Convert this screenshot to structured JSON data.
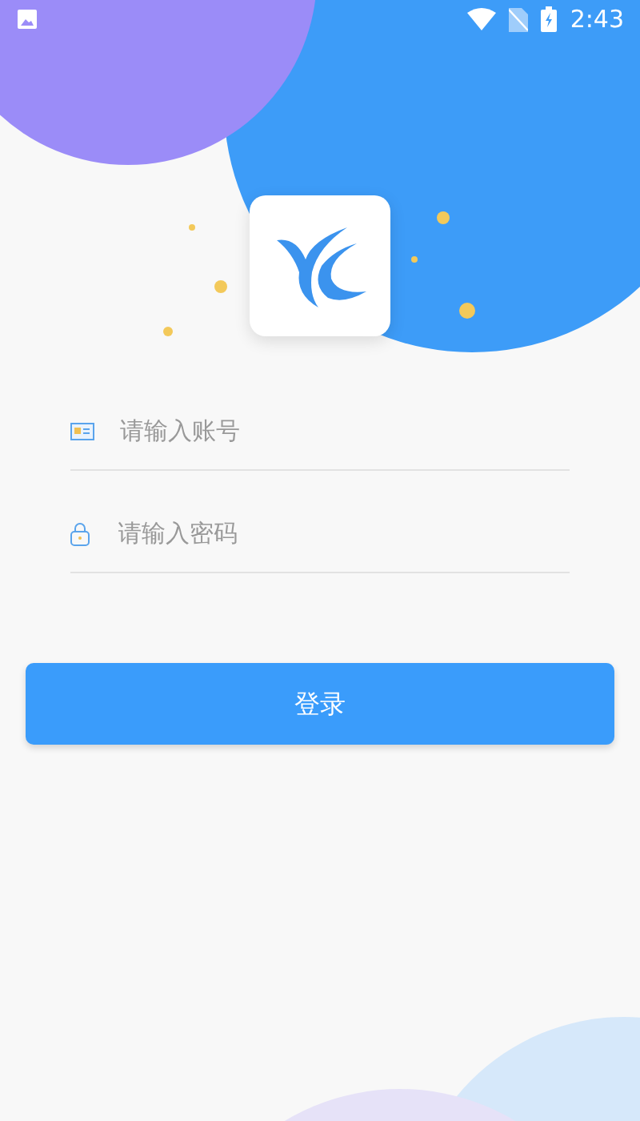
{
  "status_bar": {
    "time": "2:43"
  },
  "fields": [
    {
      "kind": "account",
      "placeholder": "请输入账号"
    },
    {
      "kind": "password",
      "placeholder": "请输入密码"
    }
  ],
  "login_button": {
    "label": "登录"
  }
}
